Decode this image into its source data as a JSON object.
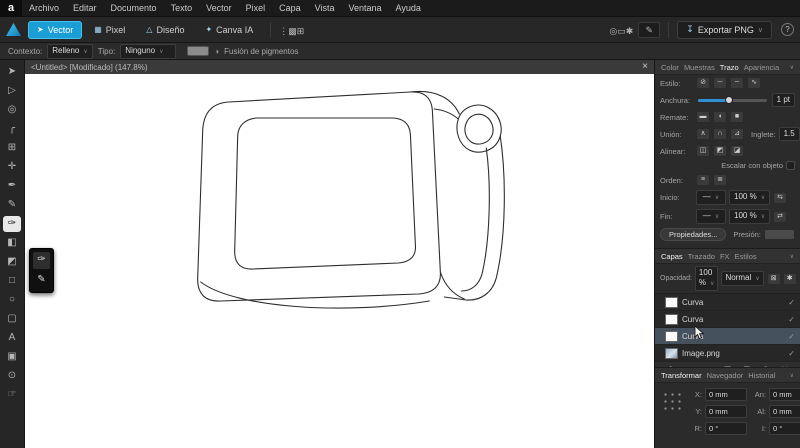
{
  "icons": {
    "chevron": "∨",
    "close": "×",
    "help": "?",
    "logo_letter": "a",
    "checkmark": "✓"
  },
  "menubar": {
    "items": [
      "Archivo",
      "Editar",
      "Documento",
      "Texto",
      "Vector",
      "Pixel",
      "Capa",
      "Vista",
      "Ventana",
      "Ayuda"
    ]
  },
  "toolbar": {
    "personas": [
      {
        "label": "Vector",
        "glyph": "➤",
        "active": true
      },
      {
        "label": "Pixel",
        "glyph": "▦",
        "active": false
      },
      {
        "label": "Diseño",
        "glyph": "△",
        "active": false
      },
      {
        "label": "Canva IA",
        "glyph": "✦",
        "active": false
      }
    ],
    "left_icons": [
      {
        "name": "tool-options-icon",
        "glyph": "⋮"
      },
      {
        "name": "swatch-panel-icon",
        "glyph": "▩"
      },
      {
        "name": "grid-options-icon",
        "glyph": "⊞"
      }
    ],
    "right_icons": [
      {
        "name": "snapping-icon",
        "glyph": "◎"
      },
      {
        "name": "guides-icon",
        "glyph": "▭"
      },
      {
        "name": "performance-icon",
        "glyph": "✱"
      }
    ],
    "pen_toggle_glyph": "✎",
    "export_label": "Exportar PNG",
    "export_icon_glyph": "↧"
  },
  "context_bar": {
    "contexto_label": "Contexto:",
    "contexto_value": "Relleno",
    "tipo_label": "Tipo:",
    "tipo_value": "Ninguno",
    "fusion_icon": "◑",
    "fusion_label": "Fusión de pigmentos"
  },
  "document": {
    "tab_title": "<Untitled> [Modificado] (147.8%)"
  },
  "tools": [
    {
      "name": "move-tool",
      "glyph": "➤",
      "active": false
    },
    {
      "name": "node-tool",
      "glyph": "▷",
      "active": false
    },
    {
      "name": "contour-tool",
      "glyph": "◎",
      "active": false
    },
    {
      "name": "corner-tool",
      "glyph": "╭",
      "active": false
    },
    {
      "name": "shape-builder-tool",
      "glyph": "⊞",
      "active": false
    },
    {
      "name": "point-transform-tool",
      "glyph": "✛",
      "active": false
    },
    {
      "name": "pen-tool",
      "glyph": "✒",
      "active": false
    },
    {
      "name": "pencil-tool",
      "glyph": "✎",
      "active": false
    },
    {
      "name": "vector-brush-tool",
      "glyph": "✑",
      "active": true
    },
    {
      "name": "fill-tool",
      "glyph": "◧",
      "active": false
    },
    {
      "name": "transparency-tool",
      "glyph": "◩",
      "active": false
    },
    {
      "name": "rectangle-tool",
      "glyph": "□",
      "active": false
    },
    {
      "name": "ellipse-tool",
      "glyph": "○",
      "active": false
    },
    {
      "name": "rounded-rectangle-tool",
      "glyph": "▢",
      "active": false
    },
    {
      "name": "artistic-text-tool",
      "glyph": "A",
      "active": false
    },
    {
      "name": "vector-crop-tool",
      "glyph": "▣",
      "active": false
    },
    {
      "name": "zoom-tool",
      "glyph": "⊙",
      "active": false
    },
    {
      "name": "view-tool",
      "glyph": "☞",
      "active": false
    }
  ],
  "tool_flyout": [
    {
      "name": "vector-brush-tool-icon",
      "glyph": "✑",
      "active": true
    },
    {
      "name": "pencil-tool-icon",
      "glyph": "✎",
      "active": false
    }
  ],
  "stroke_panel": {
    "tabs": [
      "Color",
      "Muestras",
      "Trazo",
      "Apariencia"
    ],
    "active_tab_index": 2,
    "estilo_label": "Estilo:",
    "estilo_icons": [
      {
        "name": "stroke-none-icon",
        "glyph": "⊘"
      },
      {
        "name": "stroke-solid-icon",
        "glyph": "─"
      },
      {
        "name": "stroke-dash-icon",
        "glyph": "╌"
      },
      {
        "name": "stroke-brush-icon",
        "glyph": "∿"
      }
    ],
    "anchura_label": "Anchura:",
    "anchura_value": "1 pt",
    "remate_label": "Remate:",
    "remate_icons": [
      {
        "name": "cap-butt-icon",
        "glyph": "▬"
      },
      {
        "name": "cap-round-icon",
        "glyph": "◖"
      },
      {
        "name": "cap-square-icon",
        "glyph": "■"
      }
    ],
    "union_label": "Unión:",
    "union_icons": [
      {
        "name": "join-miter-icon",
        "glyph": "∧"
      },
      {
        "name": "join-round-icon",
        "glyph": "∩"
      },
      {
        "name": "join-bevel-icon",
        "glyph": "⊿"
      }
    ],
    "inglete_label": "Inglete:",
    "inglete_value": "1.5",
    "alinear_label": "Alinear:",
    "alinear_icons": [
      {
        "name": "align-center-icon",
        "glyph": "◫"
      },
      {
        "name": "align-inside-icon",
        "glyph": "◩"
      },
      {
        "name": "align-outside-icon",
        "glyph": "◪"
      }
    ],
    "escalar_label": "Escalar con objeto",
    "orden_label": "Orden:",
    "orden_icons": [
      {
        "name": "order-dash-icon",
        "glyph": "≡"
      },
      {
        "name": "order-gap-icon",
        "glyph": "≣"
      }
    ],
    "inicio_label": "Inicio:",
    "inicio_pct": "100 %",
    "fin_label": "Fin:",
    "fin_pct": "100 %",
    "line_preview": "—",
    "swap_glyph": "⇆",
    "reverse_glyph": "⇄",
    "propiedades_button": "Propiedades...",
    "presion_label": "Presión:"
  },
  "layers_panel": {
    "tabs": [
      "Capas",
      "Trazado",
      "FX",
      "Estilos"
    ],
    "active_tab_index": 0,
    "opacidad_label": "Opacidad:",
    "opacidad_value": "100 %",
    "blend_value": "Normal",
    "header_icons": [
      {
        "name": "lock-icon",
        "glyph": "⊠"
      },
      {
        "name": "edit-all-layers-icon",
        "glyph": "✱"
      }
    ],
    "layers": [
      {
        "name": "Curva",
        "type": "curve",
        "selected": false
      },
      {
        "name": "Curva",
        "type": "curve",
        "selected": false
      },
      {
        "name": "Curva",
        "type": "curve",
        "selected": true
      },
      {
        "name": "Image.png",
        "type": "image",
        "selected": false
      }
    ],
    "footer_icons": [
      {
        "name": "fx-icon",
        "glyph": "ƒ"
      },
      {
        "name": "adjustment-icon",
        "glyph": "◐"
      },
      {
        "name": "mask-icon",
        "glyph": "◘"
      },
      {
        "name": "vector-layer-icon",
        "glyph": "▣"
      },
      {
        "name": "group-icon",
        "glyph": "⊞"
      },
      {
        "name": "add-layer-icon",
        "glyph": "⊕"
      },
      {
        "name": "delete-layer-icon",
        "glyph": "✕"
      }
    ]
  },
  "transform_panel": {
    "tabs": [
      "Transformar",
      "Navegador",
      "Historial"
    ],
    "active_tab_index": 0,
    "fields": [
      {
        "key": "x",
        "label": "X:",
        "value": "0 mm"
      },
      {
        "key": "an",
        "label": "An:",
        "value": "0 mm"
      },
      {
        "key": "y",
        "label": "Y:",
        "value": "0 mm"
      },
      {
        "key": "al",
        "label": "Al:",
        "value": "0 mm"
      },
      {
        "key": "r",
        "label": "R:",
        "value": "0 °"
      },
      {
        "key": "i",
        "label": "I:",
        "value": "0 °"
      }
    ]
  },
  "canvas": {
    "paths": [
      "M 204,28 C 188,29 179,38 178,56 L 173,203 C 172,219 180,228 196,227 L 394,220 C 409,219 417,212 416,198 L 408,36 C 407,23 399,17 386,18 Z",
      "M 232,44 C 220,45 213,52 213,63 L 210,178 C 210,190 217,196 229,195 L 374,189 C 386,188 392,182 391,171 L 386,60 C 385,49 378,44 367,44 Z",
      "M 386,18 C 412,15 428,25 435,40",
      "M 434,45 C 438,33 452,28 463,33 C 475,39 480,53 475,65 C 470,77 455,81 445,76 C 435,71 430,57 434,45 Z",
      "M 442,49 C 445,41 454,38 461,42 C 468,46 471,56 467,63 C 463,70 453,72 447,68 C 441,64 439,56 442,49 Z",
      "M 476,62 C 482,102 482,162 472,204 C 468,219 456,227 442,226 L 420,223",
      "M 462,74 C 467,110 466,164 458,199 C 455,211 447,217 437,217",
      "M 176,208 C 210,234 320,241 405,227",
      "M 416,198 C 420,210 428,220 440,225",
      "M 434,45 C 428,40 420,36 410,35"
    ]
  }
}
